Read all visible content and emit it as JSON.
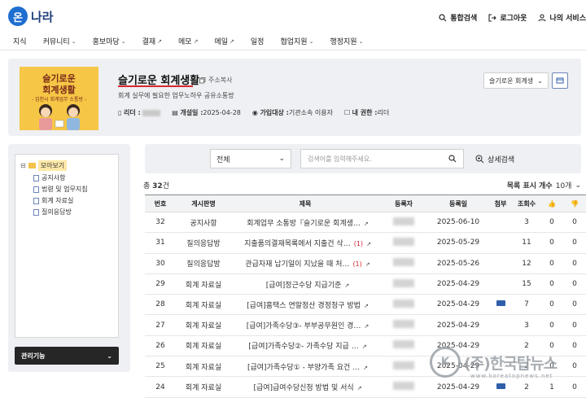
{
  "header": {
    "logo_badge": "온",
    "logo_text": "나라",
    "links": [
      {
        "label": "통합검색",
        "icon": "search-icon"
      },
      {
        "label": "로그아웃",
        "icon": "logout-icon"
      },
      {
        "label": "나의 서비스",
        "icon": "user-icon"
      }
    ]
  },
  "nav": [
    {
      "label": "지식",
      "suffix": ""
    },
    {
      "label": "커뮤니티",
      "suffix": "⌄"
    },
    {
      "label": "홍보마당",
      "suffix": "⌄"
    },
    {
      "label": "결재",
      "suffix": "↗"
    },
    {
      "label": "메모",
      "suffix": "↗"
    },
    {
      "label": "메일",
      "suffix": "↗"
    },
    {
      "label": "일정",
      "suffix": ""
    },
    {
      "label": "협업지원",
      "suffix": "⌄"
    },
    {
      "label": "행정지원",
      "suffix": "⌄"
    }
  ],
  "club": {
    "image_line1": "슬기로운",
    "image_line2": "회계생활",
    "image_line3": "- 김천시 회계업무 소통방 -",
    "title": "슬기로운 회계생활",
    "copy_address": "주소복사",
    "description": "회계 실무에 필요한 업무노하우 공유소통방",
    "meta": {
      "leader_label": "리더 :",
      "opened_label": "개설일 :",
      "opened_value": "2025-04-28",
      "join_label": "가입대상 :",
      "join_value": "기관소속 이용자",
      "role_label": "내 권한 :",
      "role_value": "리더"
    },
    "select_value": "슬기로운 회계생",
    "select_chevron": "⌄"
  },
  "sidebar": {
    "root_label": "모아보기",
    "items": [
      "공지사항",
      "법령 및 업무지침",
      "회계 자료실",
      "질의응답방"
    ],
    "manage_button": "관리기능",
    "manage_chevron": "⌄"
  },
  "search": {
    "filter_value": "전체",
    "filter_chevron": "⌄",
    "placeholder": "검색어를 입력해주세요.",
    "advanced_label": "상세검색"
  },
  "list": {
    "total_prefix": "총",
    "total_count": "32",
    "total_suffix": "건",
    "per_page_label": "목록 표시 개수",
    "per_page_value": "10개",
    "per_page_chevron": "⌄"
  },
  "table": {
    "headers": [
      "번호",
      "게시판명",
      "제목",
      "등록자",
      "등록일",
      "첨부",
      "조회수",
      "👍",
      "👎"
    ],
    "rows": [
      {
        "no": "32",
        "board": "공지사항",
        "title": "회계업무 소통방『슬기로운 회계생…",
        "comments": "",
        "date": "2025-06-10",
        "file": false,
        "views": "3",
        "up": "0",
        "down": "0"
      },
      {
        "no": "31",
        "board": "질의응답방",
        "title": "지출품의결재목록에서 지출건 삭…",
        "comments": "(1)",
        "date": "2025-05-29",
        "file": false,
        "views": "11",
        "up": "0",
        "down": "0"
      },
      {
        "no": "30",
        "board": "질의응답방",
        "title": "관급자재 납기일이 지났을 때 처…",
        "comments": "(1)",
        "date": "2025-05-26",
        "file": false,
        "views": "12",
        "up": "0",
        "down": "0"
      },
      {
        "no": "29",
        "board": "회계 자료실",
        "title": "[급여]정근수당 지급기준",
        "comments": "",
        "date": "2025-04-29",
        "file": false,
        "views": "15",
        "up": "0",
        "down": "0"
      },
      {
        "no": "28",
        "board": "회계 자료실",
        "title": "[급여]홈택스 연말정산 경정청구 방법",
        "comments": "",
        "date": "2025-04-29",
        "file": true,
        "views": "7",
        "up": "0",
        "down": "0"
      },
      {
        "no": "27",
        "board": "회계 자료실",
        "title": "[급여]가족수당③- 부부공무원인 경…",
        "comments": "",
        "date": "2025-04-29",
        "file": false,
        "views": "3",
        "up": "0",
        "down": "0"
      },
      {
        "no": "26",
        "board": "회계 자료실",
        "title": "[급여]가족수당②- 가족수당 지급 …",
        "comments": "",
        "date": "2025-04-29",
        "file": false,
        "views": "2",
        "up": "0",
        "down": "0"
      },
      {
        "no": "25",
        "board": "회계 자료실",
        "title": "[급여]가족수당① - 부양가족 요건 …",
        "comments": "",
        "date": "2025-04-29",
        "file": false,
        "views": "2",
        "up": "0",
        "down": "0"
      },
      {
        "no": "24",
        "board": "회계 자료실",
        "title": "[급여]급여수당신청 방법 및 서식",
        "comments": "",
        "date": "2025-04-29",
        "file": true,
        "views": "2",
        "up": "1",
        "down": "0"
      }
    ]
  },
  "watermark": {
    "mark": "K",
    "text": "(주)한국탑뉴스",
    "url": "www.koreatopnews.net"
  }
}
